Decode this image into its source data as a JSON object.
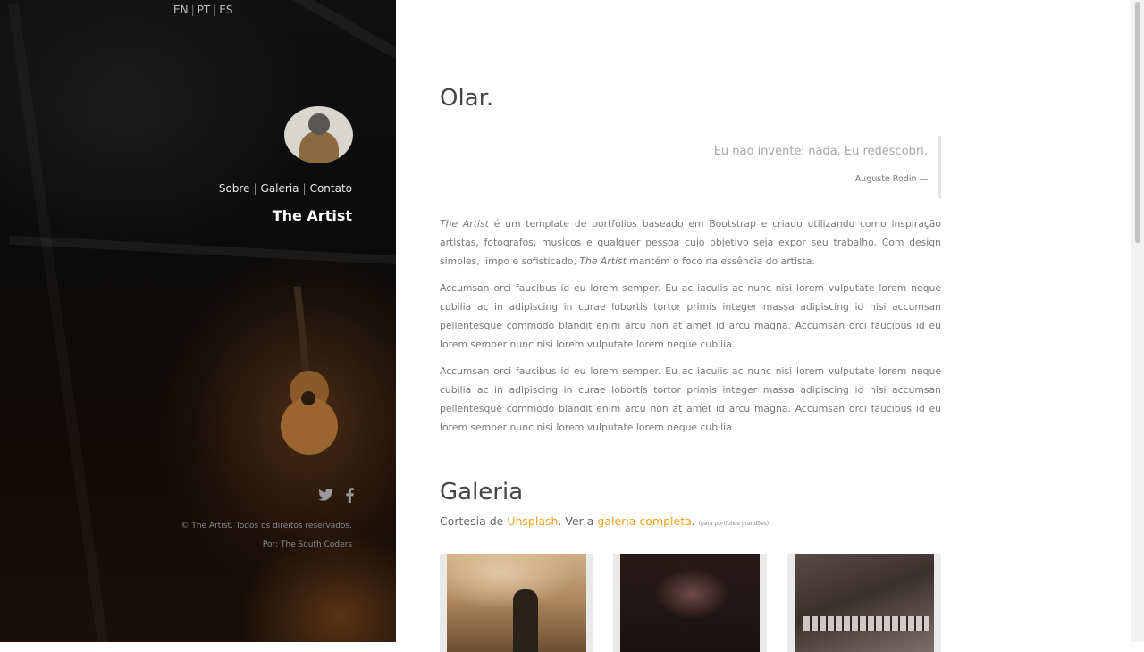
{
  "sidebar": {
    "languages": [
      "EN",
      "PT",
      "ES"
    ],
    "nav": [
      "Sobre",
      "Galeria",
      "Contato"
    ],
    "brand": "The Artist",
    "social": [
      "twitter-icon",
      "facebook-icon"
    ],
    "footer_copyright": "© The Artist. Todos os direitos reservados.",
    "footer_by_prefix": "Por: ",
    "footer_by_link": "The South Coders"
  },
  "main": {
    "title": "Olar.",
    "quote": {
      "text": "Eu não inventei nada. Eu redescobri.",
      "source": "Auguste Rodin —"
    },
    "p1": {
      "em1": "The Artist",
      "text1": " é um template de portfólios baseado em Bootstrap e criado utilizando como inspiração artistas, fotografos, musicos e qualquer pessoa cujo objetivo seja expor seu trabalho. Com design simples, limpo e sofisticado, ",
      "em2": "The Artist",
      "text2": " mantém o foco na essência do artista."
    },
    "p2": "Accumsan orci faucibus id eu lorem semper. Eu ac iaculis ac nunc nisi lorem vulputate lorem neque cubilia ac in adipiscing in curae lobortis tortor primis integer massa adipiscing id nisi accumsan pellentesque commodo blandit enim arcu non at amet id arcu magna. Accumsan orci faucibus id eu lorem semper nunc nisi lorem vulputate lorem neque cubilia.",
    "p3": "Accumsan orci faucibus id eu lorem semper. Eu ac iaculis ac nunc nisi lorem vulputate lorem neque cubilia ac in adipiscing in curae lobortis tortor primis integer massa adipiscing id nisi accumsan pellentesque commodo blandit enim arcu non at amet id arcu magna. Accumsan orci faucibus id eu lorem semper nunc nisi lorem vulputate lorem neque cubilia."
  },
  "gallery": {
    "title": "Galeria",
    "courtesy_prefix": "Cortesia de ",
    "unsplash_link": "Unsplash",
    "see_prefix": ". Ver a ",
    "full_link": "galeria completa",
    "suffix": ".",
    "note": "(para portfolios grandões)"
  },
  "colors": {
    "accent": "#f0a020",
    "sidebar_bg": "#0b0b0b"
  }
}
